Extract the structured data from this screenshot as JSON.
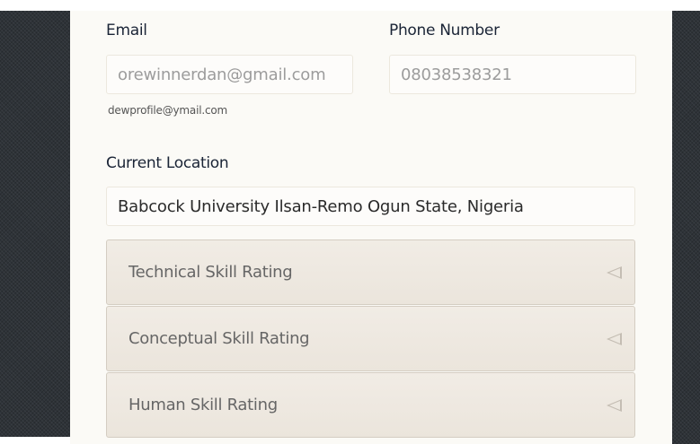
{
  "form": {
    "email": {
      "label": "Email",
      "value": "orewinnerdan@gmail.com",
      "helper": "dewprofile@ymail.com"
    },
    "phone": {
      "label": "Phone Number",
      "value": "08038538321"
    },
    "location": {
      "label": "Current Location",
      "value": "Babcock University Ilsan-Remo Ogun State, Nigeria"
    }
  },
  "accordions": [
    {
      "label": "Technical Skill Rating",
      "icon": "collapse-left-triangle"
    },
    {
      "label": "Conceptual Skill Rating",
      "icon": "collapse-left-triangle"
    },
    {
      "label": "Human Skill Rating",
      "icon": "collapse-left-triangle"
    }
  ],
  "colors": {
    "panel_background": "#fbfaf6",
    "label_text": "#1a2436",
    "muted_text": "#9c9c9c",
    "accordion_background": "#ede8e0",
    "outer_background": "#2e3338"
  }
}
